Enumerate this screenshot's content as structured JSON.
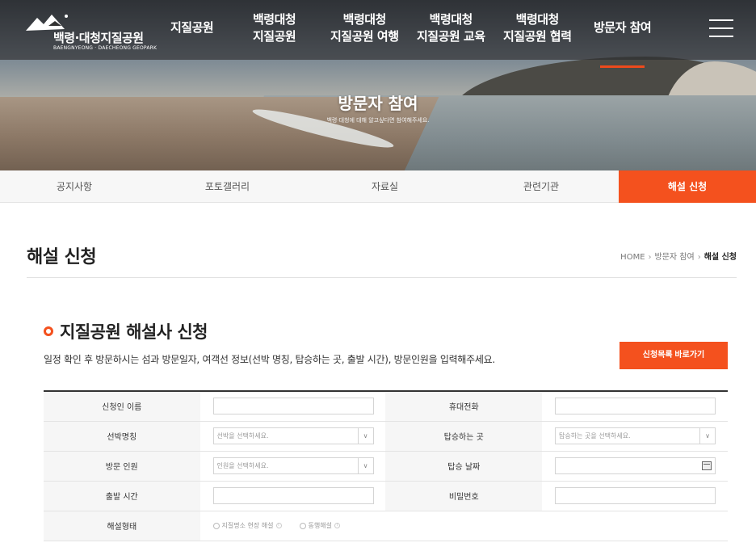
{
  "logo": {
    "name": "백령·대청지질공원",
    "subtitle": "BAENGNYEONG · DAECHEONG GEOPARK"
  },
  "gnb": {
    "items": [
      {
        "label": "지질공원"
      },
      {
        "label": "백령대청\n지질공원"
      },
      {
        "label": "백령대청\n지질공원 여행"
      },
      {
        "label": "백령대청\n지질공원 교육"
      },
      {
        "label": "백령대청\n지질공원 협력"
      },
      {
        "label": "방문자 참여"
      }
    ],
    "menu_icon": "hamburger-menu-icon"
  },
  "hero": {
    "title": "방문자 참여",
    "subtitle": "백령·대청에 대해 알고싶다면 참여해주세요."
  },
  "subnav": {
    "items": [
      {
        "label": "공지사항"
      },
      {
        "label": "포토갤러리"
      },
      {
        "label": "자료실"
      },
      {
        "label": "관련기관"
      },
      {
        "label": "해설 신청"
      }
    ]
  },
  "page": {
    "title": "해설 신청",
    "breadcrumb": [
      "HOME",
      "방문자 참여",
      "해설 신청"
    ]
  },
  "section": {
    "title": "지질공원 해설사 신청",
    "description": "일정 확인 후 방문하시는 섬과 방문일자, 여객선 정보(선박 명칭, 탑승하는 곳, 출발 시간), 방문인원을 입력해주세요.",
    "list_button": "신청목록 바로가기"
  },
  "form": {
    "applicant_name_label": "신청인 이름",
    "phone_label": "휴대전화",
    "ship_name_label": "선박명칭",
    "ship_placeholder": "선박을 선택하세요.",
    "boarding_place_label": "탑승하는 곳",
    "boarding_place_placeholder": "탑승하는 곳을 선택하세요.",
    "visitors_label": "방문 인원",
    "visitors_placeholder": "인원을 선택하세요.",
    "boarding_date_label": "탑승 날짜",
    "departure_time_label": "출발 시간",
    "password_label": "비밀번호",
    "guide_type_label": "해설형태",
    "guide_options": [
      "지질명소 현장 해설",
      "동행해설"
    ]
  },
  "colors": {
    "accent": "#f4511e",
    "header_overlay": "#26282c"
  }
}
